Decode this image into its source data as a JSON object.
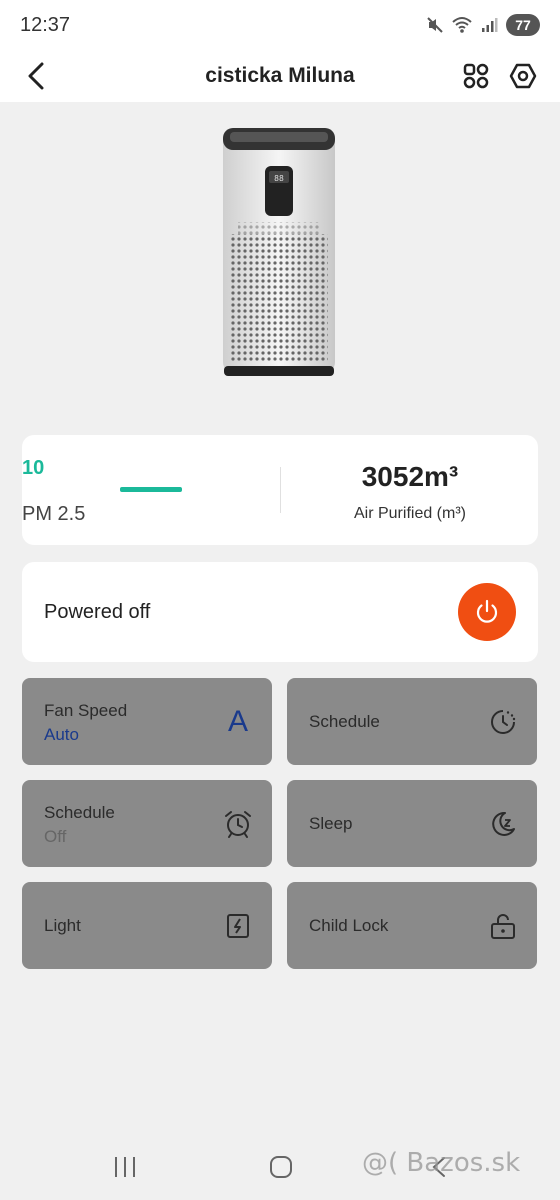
{
  "status_bar": {
    "time": "12:37",
    "battery": "77"
  },
  "header": {
    "title": "cisticka Miluna"
  },
  "stats": {
    "pm_value": "10",
    "pm_label": "PM 2.5",
    "air_value": "3052m³",
    "air_label": "Air Purified (m³)"
  },
  "power": {
    "label": "Powered off",
    "button_color": "#f04e12"
  },
  "tiles": [
    {
      "title": "Fan Speed",
      "subtitle": "Auto",
      "icon_glyph": "A",
      "icon": "fan-speed-icon"
    },
    {
      "title": "Schedule",
      "subtitle": "",
      "icon": "clock-icon"
    },
    {
      "title": "Schedule",
      "subtitle": "Off",
      "icon": "alarm-clock-icon"
    },
    {
      "title": "Sleep",
      "subtitle": "",
      "icon": "moon-icon"
    },
    {
      "title": "Light",
      "subtitle": "",
      "icon": "light-icon"
    },
    {
      "title": "Child Lock",
      "subtitle": "",
      "icon": "lock-icon"
    }
  ],
  "watermark": "@( Bazos.sk",
  "colors": {
    "accent_green": "#1bb99a",
    "tile_bg": "#8a8a8a",
    "fan_auto_blue": "#1a3a8c"
  }
}
